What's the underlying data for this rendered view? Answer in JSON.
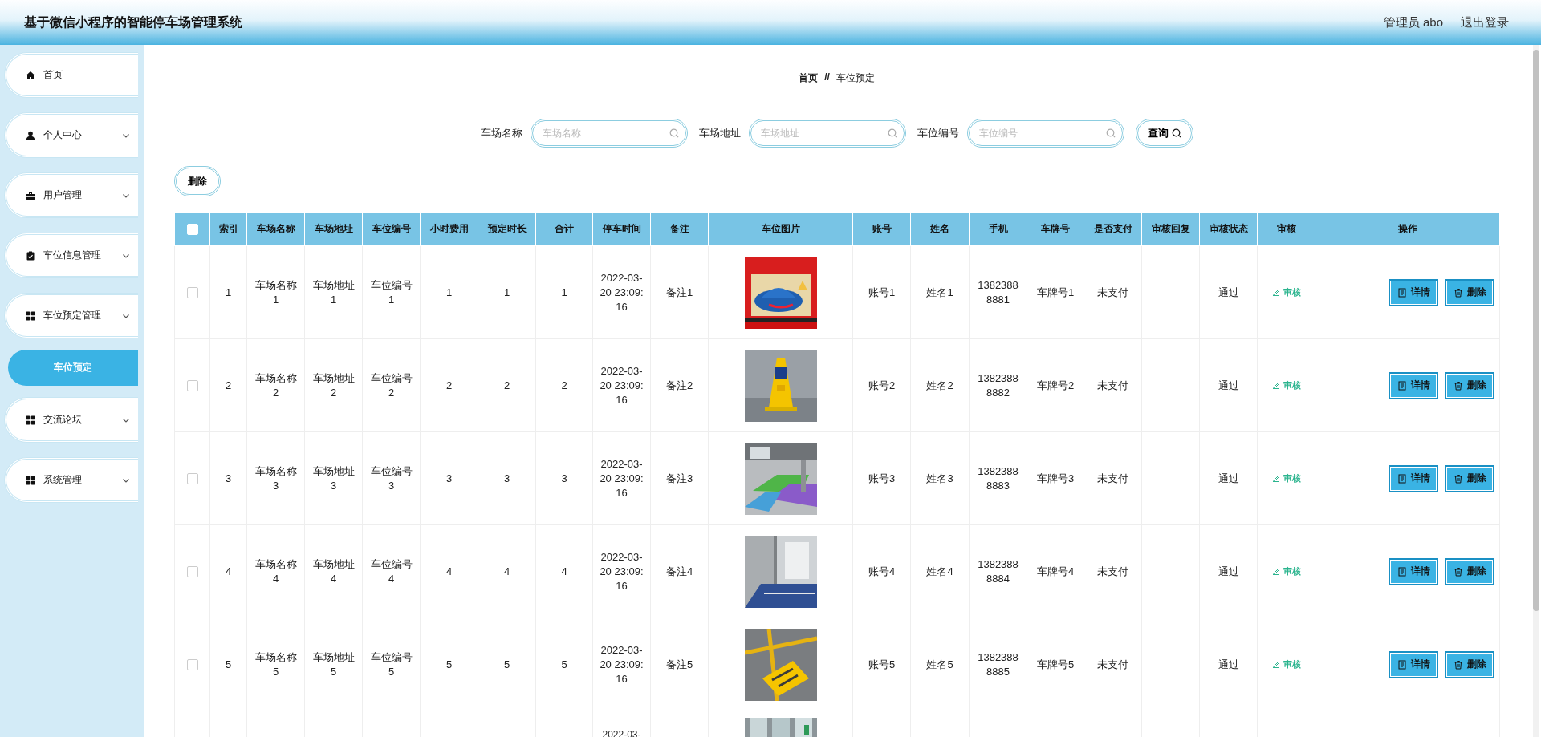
{
  "header": {
    "title": "基于微信小程序的智能停车场管理系统",
    "user": "管理员 abo",
    "logout": "退出登录"
  },
  "sidebar": {
    "items": [
      {
        "label": "首页",
        "expandable": false
      },
      {
        "label": "个人中心",
        "expandable": true
      },
      {
        "label": "用户管理",
        "expandable": true
      },
      {
        "label": "车位信息管理",
        "expandable": true
      },
      {
        "label": "车位预定管理",
        "expandable": true,
        "children": [
          {
            "label": "车位预定",
            "selected": true
          }
        ]
      },
      {
        "label": "交流论坛",
        "expandable": true
      },
      {
        "label": "系统管理",
        "expandable": true
      }
    ]
  },
  "breadcrumb": {
    "home": "首页",
    "separator": "//",
    "current": "车位预定"
  },
  "search": {
    "fields": [
      {
        "label": "车场名称",
        "placeholder": "车场名称"
      },
      {
        "label": "车场地址",
        "placeholder": "车场地址"
      },
      {
        "label": "车位编号",
        "placeholder": "车位编号"
      }
    ],
    "button": "查询"
  },
  "bulk_delete": "删除",
  "table": {
    "header_checked": false,
    "columns": [
      "索引",
      "车场名称",
      "车场地址",
      "车位编号",
      "小时费用",
      "预定时长",
      "合计",
      "停车时间",
      "备注",
      "车位图片",
      "账号",
      "姓名",
      "手机",
      "车牌号",
      "是否支付",
      "审核回复",
      "审核状态",
      "审核",
      "操作"
    ],
    "rows": [
      {
        "checked": false,
        "partial": false,
        "cells": [
          "1",
          "车场名称1",
          "车场地址1",
          "车位编号1",
          "1",
          "1",
          "1",
          "2022-03-20 23:09:16",
          "备注1",
          {
            "kind": "picture"
          },
          "账号1",
          "姓名1",
          "13823888881",
          "车牌号1",
          "未支付",
          "",
          "通过"
        ],
        "audit": "审核",
        "actions": [
          "详情",
          "删除"
        ]
      },
      {
        "checked": false,
        "partial": false,
        "cells": [
          "2",
          "车场名称2",
          "车场地址2",
          "车位编号2",
          "2",
          "2",
          "2",
          "2022-03-20 23:09:16",
          "备注2",
          {
            "kind": "picture"
          },
          "账号2",
          "姓名2",
          "13823888882",
          "车牌号2",
          "未支付",
          "",
          "通过"
        ],
        "audit": "审核",
        "actions": [
          "详情",
          "删除"
        ]
      },
      {
        "checked": false,
        "partial": false,
        "cells": [
          "3",
          "车场名称3",
          "车场地址3",
          "车位编号3",
          "3",
          "3",
          "3",
          "2022-03-20 23:09:16",
          "备注3",
          {
            "kind": "picture"
          },
          "账号3",
          "姓名3",
          "13823888883",
          "车牌号3",
          "未支付",
          "",
          "通过"
        ],
        "audit": "审核",
        "actions": [
          "详情",
          "删除"
        ]
      },
      {
        "checked": false,
        "partial": false,
        "cells": [
          "4",
          "车场名称4",
          "车场地址4",
          "车位编号4",
          "4",
          "4",
          "4",
          "2022-03-20 23:09:16",
          "备注4",
          {
            "kind": "picture"
          },
          "账号4",
          "姓名4",
          "13823888884",
          "车牌号4",
          "未支付",
          "",
          "通过"
        ],
        "audit": "审核",
        "actions": [
          "详情",
          "删除"
        ]
      },
      {
        "checked": false,
        "partial": false,
        "cells": [
          "5",
          "车场名称5",
          "车场地址5",
          "车位编号5",
          "5",
          "5",
          "5",
          "2022-03-20 23:09:16",
          "备注5",
          {
            "kind": "picture"
          },
          "账号5",
          "姓名5",
          "13823888885",
          "车牌号5",
          "未支付",
          "",
          "通过"
        ],
        "audit": "审核",
        "actions": [
          "详情",
          "删除"
        ]
      },
      {
        "partial": true,
        "cells": [
          "",
          "",
          "",
          "",
          "",
          "",
          "",
          "2022-03-",
          "",
          {
            "kind": "picture"
          },
          "",
          "",
          "",
          "",
          "",
          "",
          ""
        ]
      }
    ]
  }
}
